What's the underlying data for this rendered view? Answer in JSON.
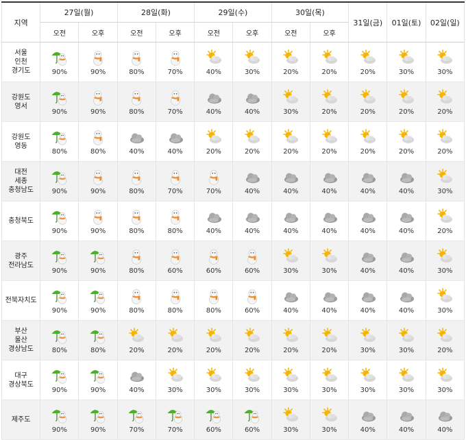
{
  "header": {
    "region": "지역",
    "days": [
      {
        "label": "27일(월)",
        "split": true
      },
      {
        "label": "28일(화)",
        "split": true
      },
      {
        "label": "29일(수)",
        "split": true
      },
      {
        "label": "30일(목)",
        "split": true
      },
      {
        "label": "31일(금)",
        "split": false
      },
      {
        "label": "01일(토)",
        "split": false
      },
      {
        "label": "02일(일)",
        "split": false
      }
    ],
    "am": "오전",
    "pm": "오후"
  },
  "rows": [
    {
      "region": [
        "서울",
        "인천",
        "경기도"
      ],
      "cells": [
        {
          "icon": "rain-umbrella-icon",
          "pct": "90%"
        },
        {
          "icon": "snowman-icon",
          "pct": "90%"
        },
        {
          "icon": "snowman-icon",
          "pct": "80%"
        },
        {
          "icon": "snowman-icon",
          "pct": "70%"
        },
        {
          "icon": "partly-cloudy-icon",
          "pct": "40%"
        },
        {
          "icon": "partly-cloudy-icon",
          "pct": "30%"
        },
        {
          "icon": "partly-cloudy-icon",
          "pct": "20%"
        },
        {
          "icon": "partly-cloudy-icon",
          "pct": "20%"
        },
        {
          "icon": "partly-cloudy-icon",
          "pct": "20%"
        },
        {
          "icon": "partly-cloudy-icon",
          "pct": "30%"
        },
        {
          "icon": "partly-cloudy-icon",
          "pct": "30%"
        }
      ]
    },
    {
      "region": [
        "강원도",
        "영서"
      ],
      "cells": [
        {
          "icon": "rain-umbrella-icon",
          "pct": "90%"
        },
        {
          "icon": "snowman-icon",
          "pct": "90%"
        },
        {
          "icon": "snowman-icon",
          "pct": "80%"
        },
        {
          "icon": "snowman-icon",
          "pct": "70%"
        },
        {
          "icon": "cloudy-icon",
          "pct": "40%"
        },
        {
          "icon": "cloudy-icon",
          "pct": "40%"
        },
        {
          "icon": "partly-cloudy-icon",
          "pct": "30%"
        },
        {
          "icon": "partly-cloudy-icon",
          "pct": "20%"
        },
        {
          "icon": "partly-cloudy-icon",
          "pct": "20%"
        },
        {
          "icon": "partly-cloudy-icon",
          "pct": "20%"
        },
        {
          "icon": "partly-cloudy-icon",
          "pct": "20%"
        }
      ]
    },
    {
      "region": [
        "강원도",
        "영동"
      ],
      "cells": [
        {
          "icon": "rain-umbrella-icon",
          "pct": "80%"
        },
        {
          "icon": "snowman-icon",
          "pct": "80%"
        },
        {
          "icon": "cloudy-icon",
          "pct": "40%"
        },
        {
          "icon": "cloudy-icon",
          "pct": "40%"
        },
        {
          "icon": "partly-cloudy-icon",
          "pct": "20%"
        },
        {
          "icon": "partly-cloudy-icon",
          "pct": "20%"
        },
        {
          "icon": "partly-cloudy-icon",
          "pct": "20%"
        },
        {
          "icon": "partly-cloudy-icon",
          "pct": "20%"
        },
        {
          "icon": "partly-cloudy-icon",
          "pct": "20%"
        },
        {
          "icon": "partly-cloudy-icon",
          "pct": "20%"
        },
        {
          "icon": "partly-cloudy-icon",
          "pct": "20%"
        }
      ]
    },
    {
      "region": [
        "대전",
        "세종",
        "충청남도"
      ],
      "cells": [
        {
          "icon": "rain-umbrella-icon",
          "pct": "90%"
        },
        {
          "icon": "snowman-icon",
          "pct": "90%"
        },
        {
          "icon": "snowman-icon",
          "pct": "80%"
        },
        {
          "icon": "snowman-icon",
          "pct": "70%"
        },
        {
          "icon": "snowman-icon",
          "pct": "70%"
        },
        {
          "icon": "cloudy-icon",
          "pct": "40%"
        },
        {
          "icon": "cloudy-icon",
          "pct": "40%"
        },
        {
          "icon": "cloudy-icon",
          "pct": "40%"
        },
        {
          "icon": "cloudy-icon",
          "pct": "40%"
        },
        {
          "icon": "cloudy-icon",
          "pct": "40%"
        },
        {
          "icon": "partly-cloudy-icon",
          "pct": "30%"
        }
      ]
    },
    {
      "region": [
        "충청북도"
      ],
      "cells": [
        {
          "icon": "rain-umbrella-icon",
          "pct": "90%"
        },
        {
          "icon": "snowman-icon",
          "pct": "90%"
        },
        {
          "icon": "snowman-icon",
          "pct": "80%"
        },
        {
          "icon": "snowman-icon",
          "pct": "80%"
        },
        {
          "icon": "cloudy-icon",
          "pct": "40%"
        },
        {
          "icon": "cloudy-icon",
          "pct": "40%"
        },
        {
          "icon": "cloudy-icon",
          "pct": "40%"
        },
        {
          "icon": "cloudy-icon",
          "pct": "40%"
        },
        {
          "icon": "cloudy-icon",
          "pct": "40%"
        },
        {
          "icon": "cloudy-icon",
          "pct": "40%"
        },
        {
          "icon": "partly-cloudy-icon",
          "pct": "20%"
        }
      ]
    },
    {
      "region": [
        "광주",
        "전라남도"
      ],
      "cells": [
        {
          "icon": "rain-umbrella-icon",
          "pct": "90%"
        },
        {
          "icon": "rain-umbrella-icon",
          "pct": "90%"
        },
        {
          "icon": "snowman-icon",
          "pct": "80%"
        },
        {
          "icon": "snowman-icon",
          "pct": "60%"
        },
        {
          "icon": "snowman-icon",
          "pct": "60%"
        },
        {
          "icon": "snowman-icon",
          "pct": "60%"
        },
        {
          "icon": "partly-cloudy-icon",
          "pct": "30%"
        },
        {
          "icon": "partly-cloudy-icon",
          "pct": "30%"
        },
        {
          "icon": "cloudy-icon",
          "pct": "40%"
        },
        {
          "icon": "cloudy-icon",
          "pct": "40%"
        },
        {
          "icon": "partly-cloudy-icon",
          "pct": "30%"
        }
      ]
    },
    {
      "region": [
        "전북자치도"
      ],
      "cells": [
        {
          "icon": "rain-umbrella-icon",
          "pct": "90%"
        },
        {
          "icon": "rain-umbrella-icon",
          "pct": "90%"
        },
        {
          "icon": "snowman-icon",
          "pct": "80%"
        },
        {
          "icon": "snowman-icon",
          "pct": "80%"
        },
        {
          "icon": "snowman-icon",
          "pct": "80%"
        },
        {
          "icon": "snowman-icon",
          "pct": "60%"
        },
        {
          "icon": "cloudy-icon",
          "pct": "40%"
        },
        {
          "icon": "cloudy-icon",
          "pct": "40%"
        },
        {
          "icon": "cloudy-icon",
          "pct": "40%"
        },
        {
          "icon": "cloudy-icon",
          "pct": "40%"
        },
        {
          "icon": "partly-cloudy-icon",
          "pct": "30%"
        }
      ]
    },
    {
      "region": [
        "부산",
        "울산",
        "경상남도"
      ],
      "cells": [
        {
          "icon": "rain-umbrella-icon",
          "pct": "80%"
        },
        {
          "icon": "rain-umbrella-icon",
          "pct": "80%"
        },
        {
          "icon": "partly-cloudy-icon",
          "pct": "20%"
        },
        {
          "icon": "partly-cloudy-icon",
          "pct": "20%"
        },
        {
          "icon": "partly-cloudy-icon",
          "pct": "20%"
        },
        {
          "icon": "partly-cloudy-icon",
          "pct": "20%"
        },
        {
          "icon": "partly-cloudy-icon",
          "pct": "20%"
        },
        {
          "icon": "partly-cloudy-icon",
          "pct": "20%"
        },
        {
          "icon": "partly-cloudy-icon",
          "pct": "30%"
        },
        {
          "icon": "partly-cloudy-icon",
          "pct": "30%"
        },
        {
          "icon": "partly-cloudy-icon",
          "pct": "20%"
        }
      ]
    },
    {
      "region": [
        "대구",
        "경상북도"
      ],
      "cells": [
        {
          "icon": "rain-umbrella-icon",
          "pct": "90%"
        },
        {
          "icon": "rain-umbrella-icon",
          "pct": "90%"
        },
        {
          "icon": "cloudy-icon",
          "pct": "40%"
        },
        {
          "icon": "partly-cloudy-icon",
          "pct": "30%"
        },
        {
          "icon": "partly-cloudy-icon",
          "pct": "30%"
        },
        {
          "icon": "partly-cloudy-icon",
          "pct": "30%"
        },
        {
          "icon": "partly-cloudy-icon",
          "pct": "30%"
        },
        {
          "icon": "partly-cloudy-icon",
          "pct": "30%"
        },
        {
          "icon": "partly-cloudy-icon",
          "pct": "30%"
        },
        {
          "icon": "partly-cloudy-icon",
          "pct": "30%"
        },
        {
          "icon": "partly-cloudy-icon",
          "pct": "30%"
        }
      ]
    },
    {
      "region": [
        "제주도"
      ],
      "cells": [
        {
          "icon": "rain-umbrella-icon",
          "pct": "90%"
        },
        {
          "icon": "rain-umbrella-icon",
          "pct": "90%"
        },
        {
          "icon": "rain-umbrella-icon",
          "pct": "70%"
        },
        {
          "icon": "rain-umbrella-icon",
          "pct": "70%"
        },
        {
          "icon": "rain-umbrella-icon",
          "pct": "60%"
        },
        {
          "icon": "rain-umbrella-icon",
          "pct": "60%"
        },
        {
          "icon": "partly-cloudy-icon",
          "pct": "30%"
        },
        {
          "icon": "partly-cloudy-icon",
          "pct": "30%"
        },
        {
          "icon": "cloudy-icon",
          "pct": "40%"
        },
        {
          "icon": "cloudy-icon",
          "pct": "40%"
        },
        {
          "icon": "cloudy-icon",
          "pct": "40%"
        }
      ]
    }
  ],
  "colors": {
    "header_border": "#333333",
    "row_alt_bg": "#f2f2f2",
    "sun": "#f7b500",
    "cloud": "#d7d7d7",
    "dark_cloud": "#9a9a9a",
    "umbrella": "#4fae2f",
    "scarf": "#f08a24"
  }
}
